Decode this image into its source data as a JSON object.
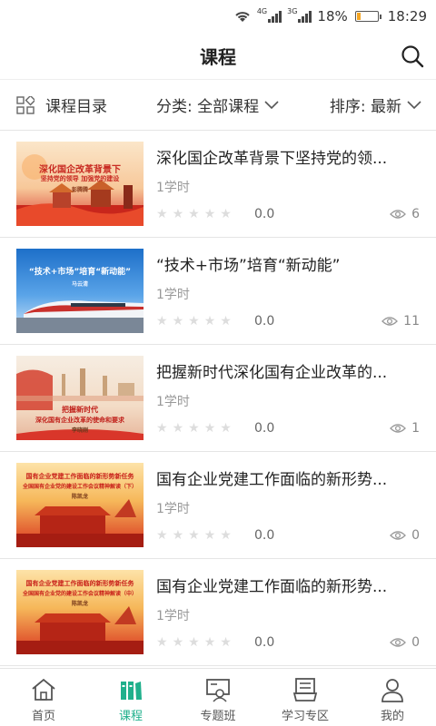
{
  "status": {
    "net1": "4G",
    "net2": "3G",
    "battery": "18%",
    "time": "18:29",
    "battery_level": 0.18
  },
  "header": {
    "title": "课程"
  },
  "filters": {
    "catalog": "课程目录",
    "category": "分类: 全部课程",
    "sort": "排序: 最新"
  },
  "courses": [
    {
      "title": "深化国企改革背景下坚持党的领...",
      "hours": "1学时",
      "rating": "0.0",
      "views": "6",
      "thumb_line1": "深化国企改革背景下",
      "thumb_line2": "坚持党的领导  加强党的建设",
      "thumb_author": "彭腾腾"
    },
    {
      "title": "“技术+市场”培育“新动能”",
      "hours": "1学时",
      "rating": "0.0",
      "views": "11",
      "thumb_line1": "“技术+市场”培育“新动能”",
      "thumb_author": "马云清"
    },
    {
      "title": "把握新时代深化国有企业改革的...",
      "hours": "1学时",
      "rating": "0.0",
      "views": "1",
      "thumb_line1": "把握新时代",
      "thumb_line2": "深化国有企业改革的使命和要求",
      "thumb_author": "李晓刚"
    },
    {
      "title": "国有企业党建工作面临的新形势...",
      "hours": "1学时",
      "rating": "0.0",
      "views": "0",
      "thumb_line1": "国有企业党建工作面临的新形势新任务",
      "thumb_line2": "全国国有企业党的建设工作会议精神解读（下）",
      "thumb_author": "陈凯龙"
    },
    {
      "title": "国有企业党建工作面临的新形势...",
      "hours": "1学时",
      "rating": "0.0",
      "views": "0",
      "thumb_line1": "国有企业党建工作面临的新形势新任务",
      "thumb_line2": "全国国有企业党的建设工作会议精神解读（中）",
      "thumb_author": "陈凯龙"
    }
  ],
  "tabs": [
    {
      "label": "首页",
      "icon": "home-icon"
    },
    {
      "label": "课程",
      "icon": "course-icon"
    },
    {
      "label": "专题班",
      "icon": "topic-class-icon"
    },
    {
      "label": "学习专区",
      "icon": "study-zone-icon"
    },
    {
      "label": "我的",
      "icon": "profile-icon"
    }
  ],
  "colors": {
    "accent": "#20b08c",
    "battery": "#f5a623"
  }
}
